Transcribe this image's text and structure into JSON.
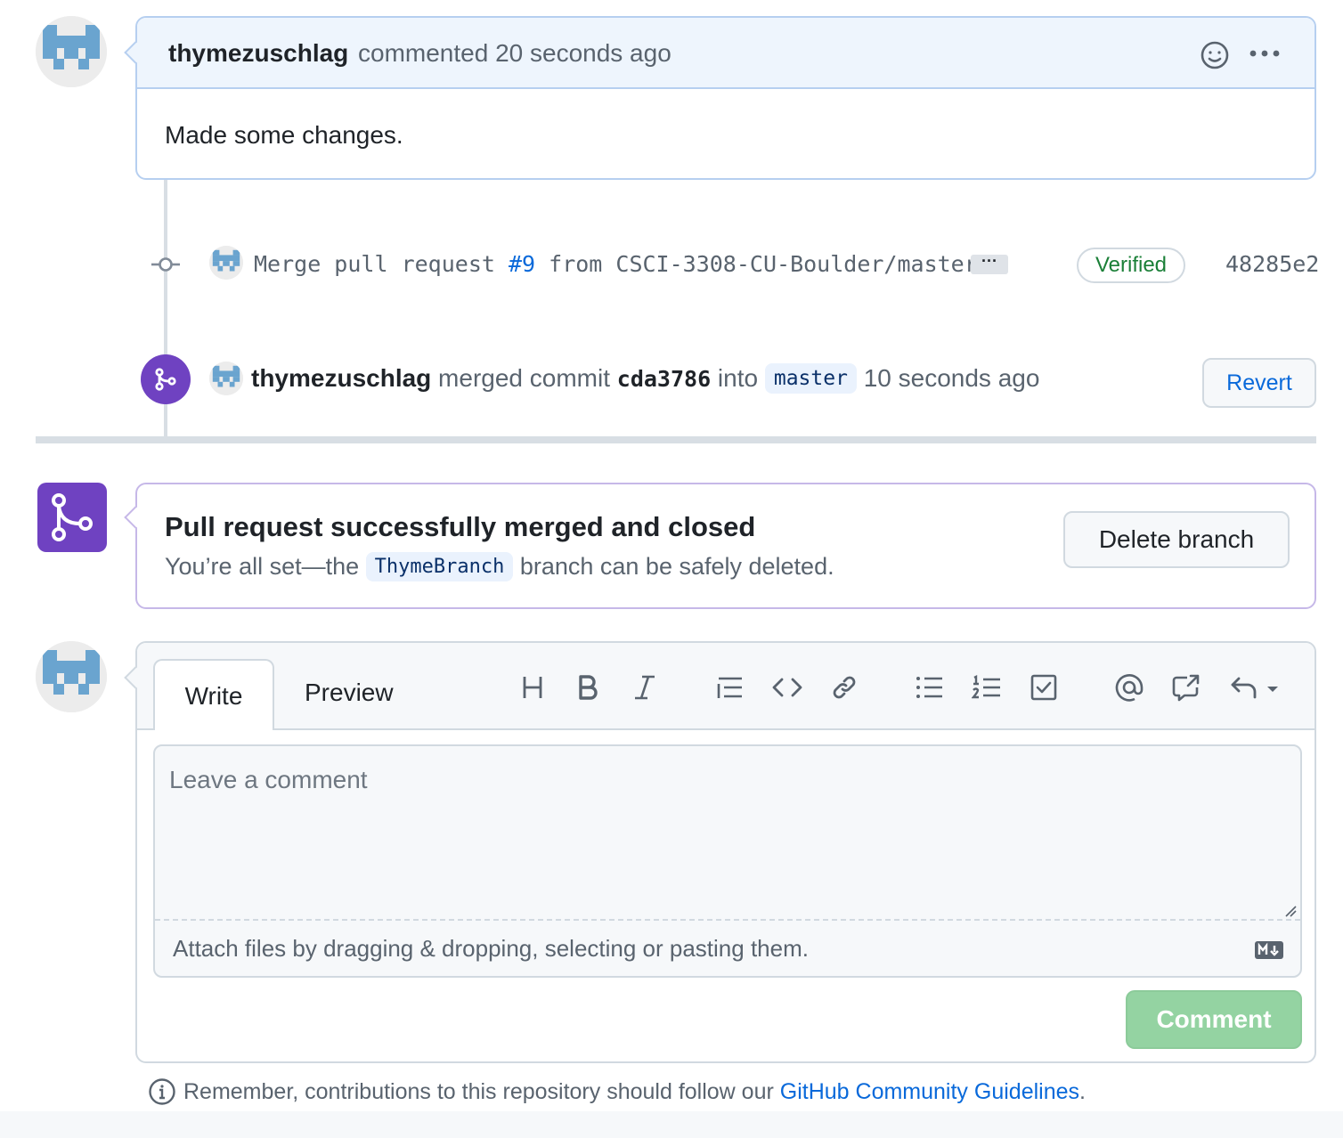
{
  "comment": {
    "author": "thymezuschlag",
    "meta": "commented 20 seconds ago",
    "body": "Made some changes."
  },
  "commit": {
    "message_prefix": "Merge pull request ",
    "pr_ref": "#9",
    "message_suffix": " from CSCI-3308-CU-Boulder/master",
    "ellipsis": "···",
    "verified": "Verified",
    "sha": "48285e2"
  },
  "merged_event": {
    "author": "thymezuschlag",
    "text1": " merged commit ",
    "commit": "cda3786",
    "text2": " into ",
    "branch": "master",
    "time": " 10 seconds ago",
    "revert": "Revert"
  },
  "merge_status": {
    "title": "Pull request successfully merged and closed",
    "sub_prefix": "You’re all set—the ",
    "branch": "ThymeBranch",
    "sub_suffix": " branch can be safely deleted.",
    "delete_button": "Delete branch"
  },
  "composer": {
    "tabs": [
      "Write",
      "Preview"
    ],
    "placeholder": "Leave a comment",
    "attach_hint": "Attach files by dragging & dropping, selecting or pasting them.",
    "submit": "Comment",
    "toolbar": [
      "heading-icon",
      "bold-icon",
      "italic-icon",
      "quote-icon",
      "code-icon",
      "link-icon",
      "bullet-list-icon",
      "numbered-list-icon",
      "task-list-icon",
      "mention-icon",
      "cross-reference-icon",
      "reply-icon"
    ]
  },
  "footer": {
    "prefix": "Remember, contributions to this repository should follow our ",
    "link": "GitHub Community Guidelines",
    "suffix": "."
  },
  "colors": {
    "merged_purple": "#6f42c1",
    "link_blue": "#0969da",
    "verified_green": "#1a7f37",
    "comment_btn_disabled": "#94d3a2"
  }
}
